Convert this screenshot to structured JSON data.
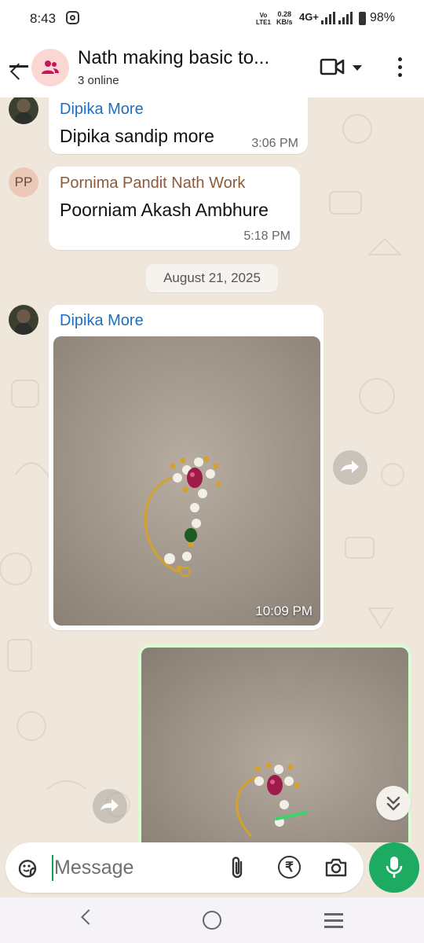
{
  "status_bar": {
    "time": "8:43",
    "volte": "Vo\nLTE1",
    "speed": "0.28\nKB/s",
    "network": "4G+",
    "battery": "98%"
  },
  "header": {
    "title": "Nath making basic to...",
    "subtitle": "3 online"
  },
  "messages": [
    {
      "sender": "Dipika More",
      "sender_color": "#1d6fbf",
      "text": "Dipika sandip more",
      "time": "3:06 PM"
    },
    {
      "sender": "Pornima Pandit Nath Work",
      "sender_color": "#8a5a3c",
      "avatar_initials": "PP",
      "text": "Poorniam Akash Ambhure",
      "time": "5:18 PM"
    }
  ],
  "date_divider": "August 21, 2025",
  "image_message": {
    "sender": "Dipika More",
    "sender_color": "#1d6fbf",
    "time": "10:09 PM"
  },
  "input": {
    "placeholder": "Message"
  },
  "colors": {
    "accent": "#1daa61",
    "header_bg": "#ffffff",
    "chat_bg": "#efe7dc",
    "outgoing_border": "#d9fdd3"
  }
}
